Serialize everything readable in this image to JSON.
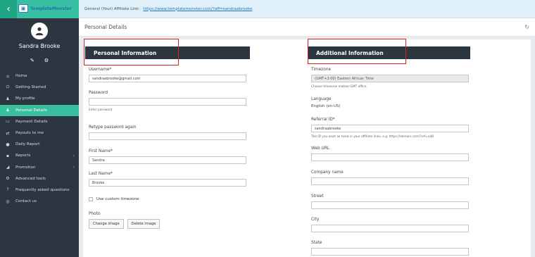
{
  "brand": {
    "logo_text": "TemplateMonster"
  },
  "topbar": {
    "affiliate_label": "General (Your) Affiliate Link:",
    "affiliate_url": "https://www.templatemonster.com/?aff=sandraabrooke"
  },
  "user": {
    "name": "Sandra Brooke"
  },
  "sidebar": {
    "items": [
      {
        "label": "Home",
        "icon": "home-icon",
        "glyph": "⌂"
      },
      {
        "label": "Getting Started",
        "icon": "power-icon",
        "glyph": "⏻"
      },
      {
        "label": "My profile",
        "icon": "user-icon",
        "glyph": "♟"
      },
      {
        "label": "Personal Details",
        "icon": "user-icon",
        "glyph": "♟"
      },
      {
        "label": "Payment Details",
        "icon": "card-icon",
        "glyph": "▭"
      },
      {
        "label": "Payouts to me",
        "icon": "arrows-icon",
        "glyph": "⇄"
      },
      {
        "label": "Daily Report",
        "icon": "report-icon",
        "glyph": "●"
      },
      {
        "label": "Reports",
        "icon": "chart-icon",
        "glyph": "▪"
      },
      {
        "label": "Promotion",
        "icon": "megaphone-icon",
        "glyph": "◢"
      },
      {
        "label": "Advanced tools",
        "icon": "tools-icon",
        "glyph": "⚙"
      },
      {
        "label": "Frequently asked questions",
        "icon": "question-icon",
        "glyph": "?"
      },
      {
        "label": "Contact us",
        "icon": "globe-icon",
        "glyph": "◎"
      }
    ]
  },
  "page": {
    "title": "Personal Details"
  },
  "personal": {
    "header": "Personal Information",
    "username_label": "Username*",
    "username_value": "sandraabrooke@gmail.com",
    "password_label": "Password",
    "password_help": "Enter password",
    "retype_label": "Retype password again",
    "first_name_label": "First Name*",
    "first_name_value": "Sandra",
    "last_name_label": "Last Name*",
    "last_name_value": "Brooke",
    "custom_tz_label": "Use custom timezone",
    "photo_label": "Photo",
    "change_image": "Change image",
    "delete_image": "Delete image"
  },
  "additional": {
    "header": "Additional Information",
    "timezone_label": "Timezone",
    "timezone_value": "(GMT+3:00) Eastern African Time",
    "timezone_help": "Choose timezone meteor-GMT office.",
    "language_label": "Language",
    "language_value": "English (en-US)",
    "referral_label": "Referral ID*",
    "referral_value": "sandraabrooke",
    "referral_help": "The ID you want as head in your affiliate links, e.g. https://domain.com/?ref=a48",
    "web_url_label": "Web URL",
    "company_label": "Company name",
    "street_label": "Street",
    "city_label": "City",
    "state_label": "State"
  }
}
